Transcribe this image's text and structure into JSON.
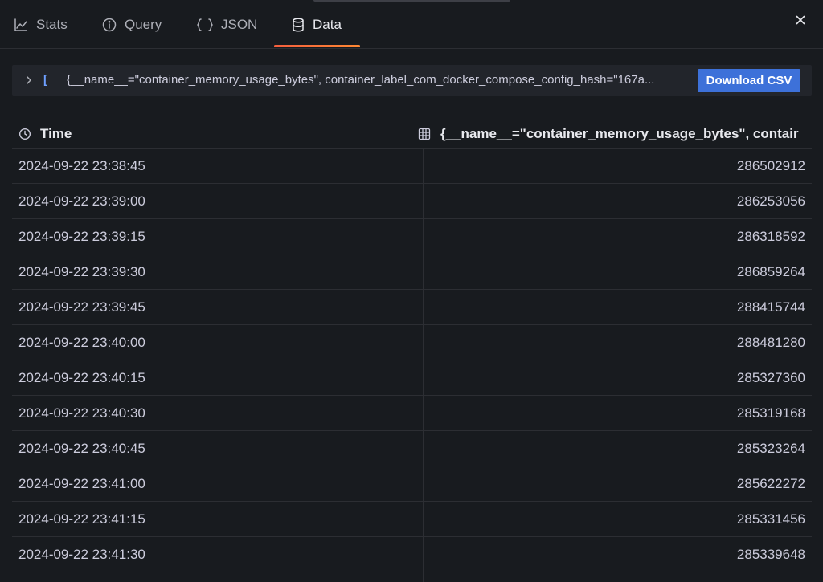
{
  "tabs": [
    {
      "label": "Stats",
      "icon": "chart-line-icon"
    },
    {
      "label": "Query",
      "icon": "info-circle-icon"
    },
    {
      "label": "JSON",
      "icon": "braces-icon"
    },
    {
      "label": "Data",
      "icon": "database-icon",
      "active": true
    }
  ],
  "series": {
    "bracket": "[",
    "name": "{__name__=\"container_memory_usage_bytes\", container_label_com_docker_compose_config_hash=\"167a...",
    "download_label": "Download CSV"
  },
  "table": {
    "columns": {
      "time": "Time",
      "value": "{__name__=\"container_memory_usage_bytes\", contair"
    },
    "rows": [
      {
        "time": "2024-09-22 23:38:45",
        "value": "286502912"
      },
      {
        "time": "2024-09-22 23:39:00",
        "value": "286253056"
      },
      {
        "time": "2024-09-22 23:39:15",
        "value": "286318592"
      },
      {
        "time": "2024-09-22 23:39:30",
        "value": "286859264"
      },
      {
        "time": "2024-09-22 23:39:45",
        "value": "288415744"
      },
      {
        "time": "2024-09-22 23:40:00",
        "value": "288481280"
      },
      {
        "time": "2024-09-22 23:40:15",
        "value": "285327360"
      },
      {
        "time": "2024-09-22 23:40:30",
        "value": "285319168"
      },
      {
        "time": "2024-09-22 23:40:45",
        "value": "285323264"
      },
      {
        "time": "2024-09-22 23:41:00",
        "value": "285622272"
      },
      {
        "time": "2024-09-22 23:41:15",
        "value": "285331456"
      },
      {
        "time": "2024-09-22 23:41:30",
        "value": "285339648"
      }
    ]
  },
  "colors": {
    "background": "#181b1f",
    "accent_tab": "#f55f3e",
    "primary_button": "#3d71d9",
    "bracket": "#6e9fff"
  }
}
